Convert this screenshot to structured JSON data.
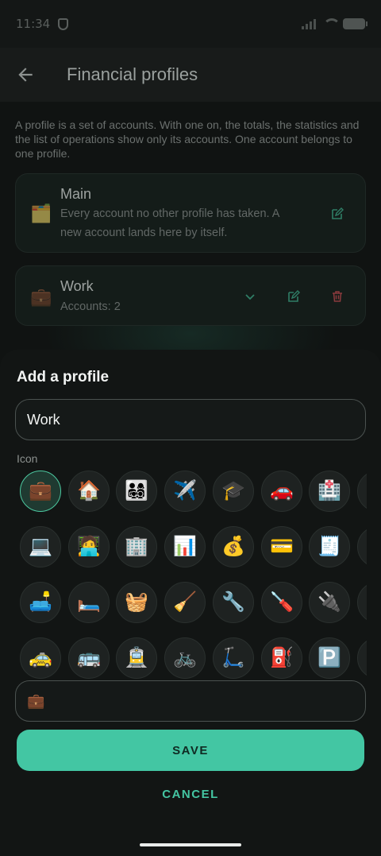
{
  "status_bar": {
    "time": "11:34"
  },
  "app_bar": {
    "title": "Financial profiles"
  },
  "description": "A profile is a set of accounts. With one on, the totals, the statistics and the list of operations show only its accounts. One account belongs to one profile.",
  "profiles": [
    {
      "emoji": "🗂️",
      "name": "Main",
      "subtitle": "Every account no other profile has taken. A new account lands here by itself."
    },
    {
      "emoji": "💼",
      "name": "Work",
      "subtitle": "Accounts: 2"
    }
  ],
  "sheet": {
    "title": "Add a profile",
    "name_value": "Work",
    "icon_label": "Icon",
    "selected_icon": "💼",
    "icons": [
      [
        "💼",
        "🏠",
        "👨‍👩‍👧‍👦",
        "✈️",
        "🎓",
        "🚗",
        "🏥",
        ""
      ],
      [
        "💻",
        "🧑‍💻",
        "🏢",
        "📊",
        "💰",
        "💳",
        "🧾",
        ""
      ],
      [
        "🛋️",
        "🛏️",
        "🧺",
        "🧹",
        "🔧",
        "🪛",
        "🔌",
        ""
      ],
      [
        "🚕",
        "🚌",
        "🚊",
        "🚲",
        "🛴",
        "⛽",
        "🅿️",
        ""
      ]
    ],
    "save_label": "SAVE",
    "cancel_label": "CANCEL"
  },
  "colors": {
    "accent": "#43c6a3",
    "danger": "#e0565b",
    "background": "#121514"
  }
}
